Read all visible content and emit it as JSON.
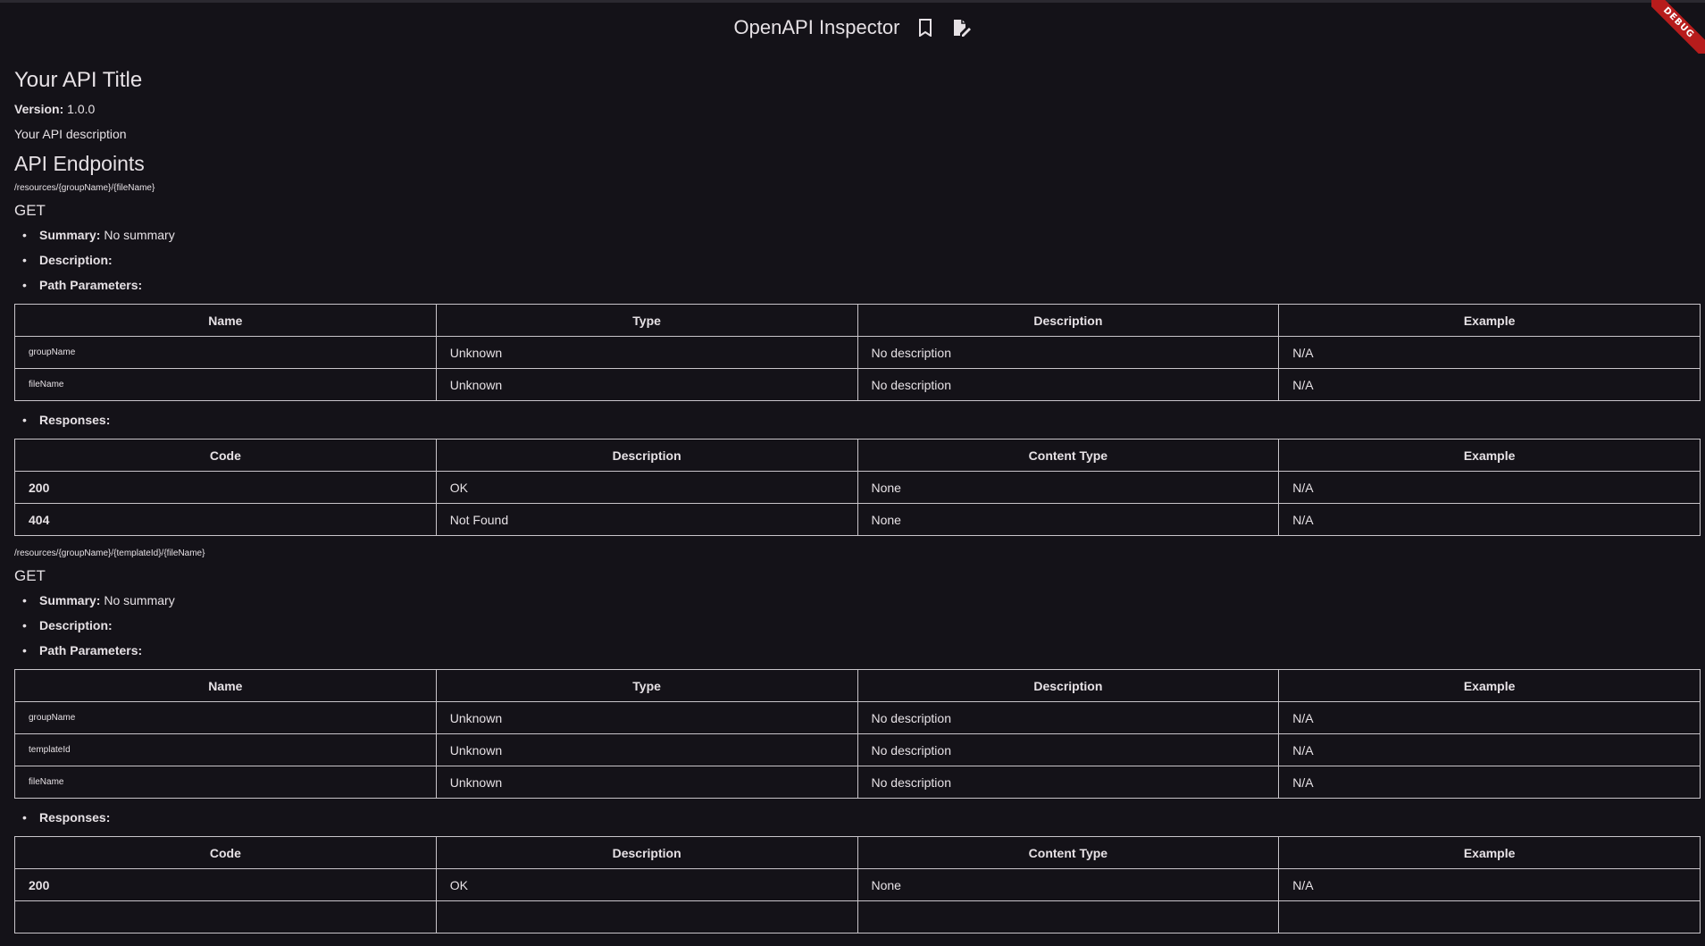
{
  "appbar": {
    "title": "OpenAPI Inspector",
    "icons": [
      "bookmark-icon",
      "edit-document-icon"
    ]
  },
  "debug_banner": "DEBUG",
  "api": {
    "title": "Your API Title",
    "version_label": "Version:",
    "version": "1.0.0",
    "description": "Your API description"
  },
  "section_title": "API Endpoints",
  "labels": {
    "summary": "Summary:",
    "description": "Description:",
    "path_parameters": "Path Parameters:",
    "responses": "Responses:"
  },
  "param_columns": [
    "Name",
    "Type",
    "Description",
    "Example"
  ],
  "response_columns": [
    "Code",
    "Description",
    "Content Type",
    "Example"
  ],
  "endpoints": [
    {
      "path": "/resources/{groupName}/{fileName}",
      "method": "GET",
      "summary": "No summary",
      "description": "",
      "params": [
        {
          "name": "groupName",
          "type": "Unknown",
          "description": "No description",
          "example": "N/A"
        },
        {
          "name": "fileName",
          "type": "Unknown",
          "description": "No description",
          "example": "N/A"
        }
      ],
      "responses": [
        {
          "code": "200",
          "description": "OK",
          "content_type": "None",
          "example": "N/A"
        },
        {
          "code": "404",
          "description": "Not Found",
          "content_type": "None",
          "example": "N/A"
        }
      ]
    },
    {
      "path": "/resources/{groupName}/{templateId}/{fileName}",
      "method": "GET",
      "summary": "No summary",
      "description": "",
      "params": [
        {
          "name": "groupName",
          "type": "Unknown",
          "description": "No description",
          "example": "N/A"
        },
        {
          "name": "templateId",
          "type": "Unknown",
          "description": "No description",
          "example": "N/A"
        },
        {
          "name": "fileName",
          "type": "Unknown",
          "description": "No description",
          "example": "N/A"
        }
      ],
      "responses": [
        {
          "code": "200",
          "description": "OK",
          "content_type": "None",
          "example": "N/A"
        },
        {
          "code": "",
          "description": "",
          "content_type": "",
          "example": ""
        }
      ]
    }
  ]
}
